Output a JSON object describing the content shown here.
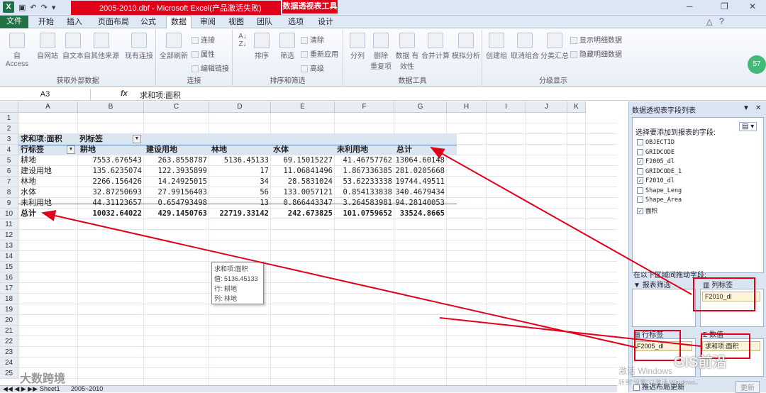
{
  "window": {
    "title": "2005-2010.dbf - Microsoft Excel(产品激活失败)",
    "context_tab": "数据透视表工具"
  },
  "ribbon_tabs": [
    "文件",
    "开始",
    "插入",
    "页面布局",
    "公式",
    "数据",
    "审阅",
    "视图",
    "团队",
    "选项",
    "设计"
  ],
  "ribbon": {
    "groups": [
      "获取外部数据",
      "连接",
      "排序和筛选",
      "数据工具",
      "分级显示"
    ],
    "buttons": {
      "from_access": "自 Access",
      "from_web": "自网站",
      "from_text": "自文本",
      "from_other": "自其他来源",
      "existing": "现有连接",
      "refresh_all": "全部刷新",
      "connections": "连接",
      "properties": "属性",
      "edit_links": "编辑链接",
      "sort": "排序",
      "filter": "筛选",
      "clear": "清除",
      "reapply": "重新应用",
      "advanced": "高级",
      "text_to_columns": "分列",
      "remove_dup": "删除\n重复项",
      "validation": "数据\n有效性",
      "consolidate": "合并计算",
      "what_if": "模拟分析",
      "group": "创建组",
      "ungroup": "取消组合",
      "subtotal": "分类汇总",
      "show_detail": "显示明细数据",
      "hide_detail": "隐藏明细数据"
    },
    "badge": "57"
  },
  "formula_bar": {
    "name_box": "A3",
    "fx": "fx",
    "formula": "求和项:面积"
  },
  "columns": [
    "A",
    "B",
    "C",
    "D",
    "E",
    "F",
    "G",
    "H",
    "I",
    "J",
    "K"
  ],
  "rows": [
    "1",
    "2",
    "3",
    "4",
    "5",
    "6",
    "7",
    "8",
    "9",
    "10",
    "11",
    "12",
    "13",
    "14",
    "15",
    "16",
    "17",
    "18",
    "19",
    "20",
    "21",
    "22",
    "23",
    "24",
    "25"
  ],
  "pivot": {
    "a3": "求和项:面积",
    "b3": "列标签",
    "a4": "行标签",
    "col_headers": [
      "耕地",
      "建设用地",
      "林地",
      "水体",
      "未利用地",
      "总计"
    ],
    "rows": [
      {
        "label": "耕地",
        "values": [
          "7553.676543",
          "263.8558787",
          "5136.45133",
          "69.15015227",
          "41.46757762",
          "13064.60148"
        ]
      },
      {
        "label": "建设用地",
        "values": [
          "135.6235074",
          "122.3935899",
          "17",
          "11.06841496",
          "1.867336385",
          "281.0205668"
        ]
      },
      {
        "label": "林地",
        "values": [
          "2266.156426",
          "14.24925015",
          "34",
          "28.5831024",
          "53.62233338",
          "19744.49511"
        ]
      },
      {
        "label": "水体",
        "values": [
          "32.87250693",
          "27.99156403",
          "56",
          "133.0057121",
          "0.854133838",
          "340.4679434"
        ]
      },
      {
        "label": "未利用地",
        "values": [
          "44.31123657",
          "0.654793498",
          "13",
          "0.866443347",
          "3.264583981",
          "94.28140053"
        ]
      }
    ],
    "total_label": "总计",
    "totals": [
      "10032.64022",
      "429.1450763",
      "22719.33142",
      "242.673825",
      "101.0759652",
      "33524.8665"
    ]
  },
  "tooltip": {
    "title": "求和项:面积",
    "value": "值: 5136.45133",
    "row": "行: 耕地",
    "col": "列: 林地"
  },
  "sheet_tabs": [
    "Sheet1",
    "2005~2010"
  ],
  "field_list": {
    "title": "数据透视表字段列表",
    "choose": "选择要添加到报表的字段:",
    "fields": [
      {
        "name": "OBJECTID",
        "checked": false
      },
      {
        "name": "GRIDCODE",
        "checked": false
      },
      {
        "name": "F2005_dl",
        "checked": true
      },
      {
        "name": "GRIDCODE_1",
        "checked": false
      },
      {
        "name": "F2010_dl",
        "checked": true
      },
      {
        "name": "Shape_Leng",
        "checked": false
      },
      {
        "name": "Shape_Area",
        "checked": false
      },
      {
        "name": "面积",
        "checked": true
      }
    ],
    "drag_text": "在以下区域间拖动字段:",
    "report_filter": "报表筛选",
    "column_labels": "列标签",
    "column_chip": "F2010_dl",
    "row_labels": "行标签",
    "row_chip": "F2005_dl",
    "values": "数值",
    "values_chip": "求和项:面积",
    "defer": "推迟布局更新",
    "update": "更新"
  },
  "watermarks": {
    "left": "大数跨境",
    "right": "GIS前沿",
    "activate": "激活 Windows",
    "activate_sub": "转到\"设置\"以激活 Windows。"
  },
  "colors": {
    "excel_green": "#217346",
    "annotation_red": "#e0001a",
    "pivot_header": "#dce6f1"
  }
}
